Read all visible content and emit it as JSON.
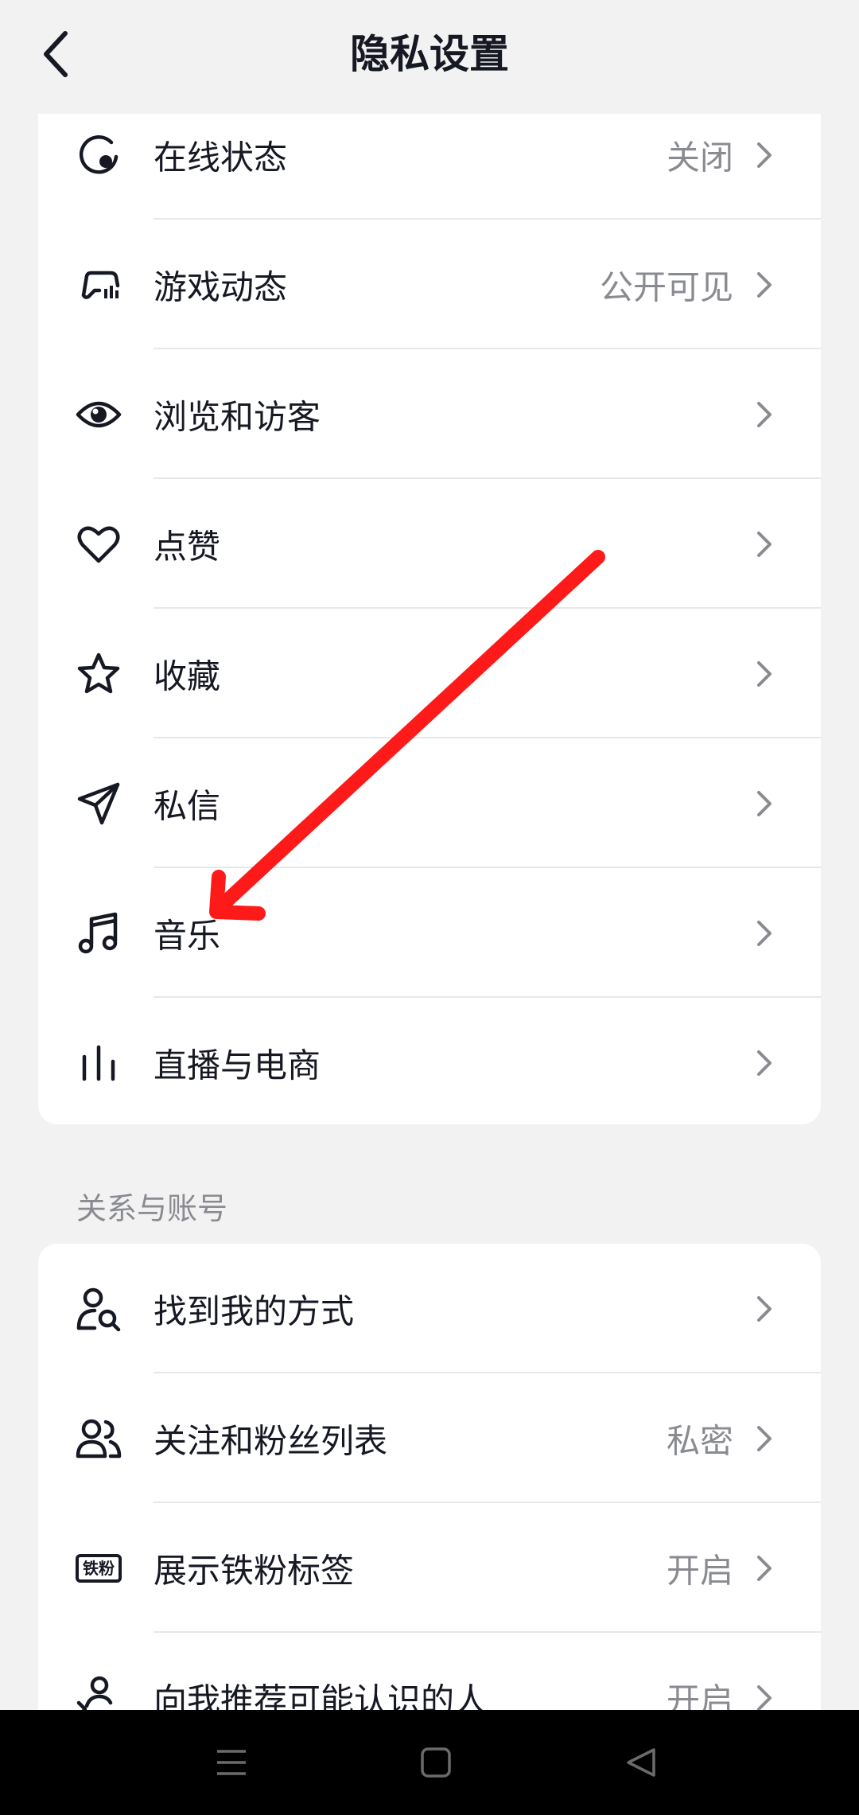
{
  "header": {
    "title": "隐私设置",
    "back_icon": "chevron-left-icon"
  },
  "section1": {
    "items": [
      {
        "label": "在线状态",
        "value": "关闭",
        "icon": "online-status-icon"
      },
      {
        "label": "游戏动态",
        "value": "公开可见",
        "icon": "game-controller-icon"
      },
      {
        "label": "浏览和访客",
        "value": "",
        "icon": "eye-icon"
      },
      {
        "label": "点赞",
        "value": "",
        "icon": "heart-icon"
      },
      {
        "label": "收藏",
        "value": "",
        "icon": "star-icon"
      },
      {
        "label": "私信",
        "value": "",
        "icon": "send-icon"
      },
      {
        "label": "音乐",
        "value": "",
        "icon": "music-note-icon"
      },
      {
        "label": "直播与电商",
        "value": "",
        "icon": "live-bars-icon"
      }
    ]
  },
  "section2": {
    "title": "关系与账号",
    "items": [
      {
        "label": "找到我的方式",
        "value": "",
        "icon": "user-search-icon"
      },
      {
        "label": "关注和粉丝列表",
        "value": "私密",
        "icon": "users-icon"
      },
      {
        "label": "展示铁粉标签",
        "value": "开启",
        "icon": "fan-badge-icon",
        "badge_text": "铁粉"
      },
      {
        "label": "向我推荐可能认识的人",
        "value": "开启",
        "icon": "recommend-user-icon"
      }
    ]
  },
  "annotation": {
    "color": "#ff1a1a",
    "description_icon": "red-arrow-annotation"
  },
  "nav": {
    "menu_icon": "menu-icon",
    "home_icon": "square-home-icon",
    "back_icon": "triangle-back-icon"
  }
}
